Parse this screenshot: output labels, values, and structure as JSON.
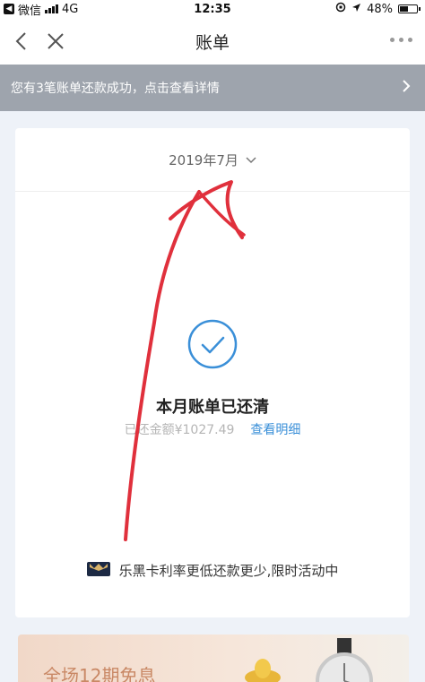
{
  "status_bar": {
    "carrier": "微信",
    "network": "4G",
    "time": "12:35",
    "battery": "48%",
    "battery_level": 0.48
  },
  "nav": {
    "title": "账单"
  },
  "notice": {
    "text": "您有3笔账单还款成功，点击查看详情"
  },
  "bill": {
    "month": "2019年7月",
    "status_title": "本月账单已还清",
    "repaid_label": "已还金额",
    "repaid_amount": "¥1027.49",
    "detail_link": "查看明细"
  },
  "promo": {
    "text": "乐黑卡利率更低还款更少,限时活动中"
  },
  "ad": {
    "text": "全场12期免息"
  },
  "colors": {
    "accent_blue": "#3a8fd8",
    "annotation_red": "#e0303c",
    "notice_bg": "#9ea4ad"
  }
}
